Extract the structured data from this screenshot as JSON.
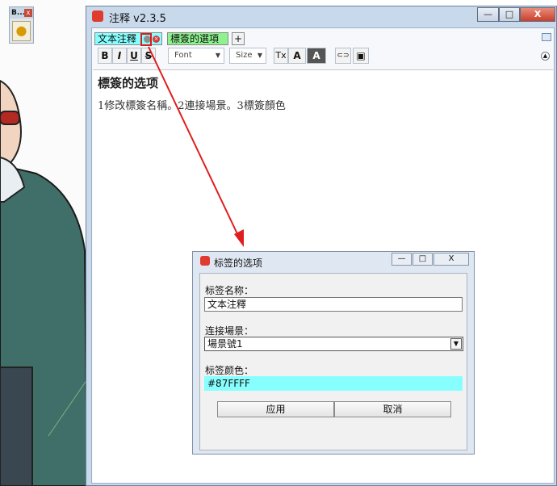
{
  "background": {
    "toolbar_title": "B...",
    "toolbar_close": "x",
    "toolbar_icon": "speech-bubble-icon"
  },
  "window": {
    "title": "注释 v2.3.5",
    "controls": {
      "minimize": "—",
      "maximize": "□",
      "close": "X"
    }
  },
  "tabs": [
    {
      "label": "文本注釋",
      "color": "#87FFFF"
    },
    {
      "label": "標簽的選項",
      "color": "#8EF38E"
    }
  ],
  "tab_add_label": "+",
  "toolbar": {
    "bold": "B",
    "italic": "I",
    "underline": "U",
    "strike": "S",
    "font_placeholder": "Font",
    "size_placeholder": "Size",
    "clear_format": "Tx",
    "text_color": "A",
    "bg_color": "A",
    "link": "⊂⊃",
    "image": "▣"
  },
  "document": {
    "heading": "標簽的选项",
    "line": "1修改標簽名稱。2連接場景。3標簽顏色"
  },
  "dialog": {
    "title": "标签的选项",
    "name_label": "标签名称：",
    "name_value": "文本注釋",
    "scene_label": "连接場景：",
    "scene_value": "場景號1",
    "color_label": "标签颜色：",
    "color_value": "#87FFFF",
    "apply_button": "应用",
    "cancel_button": "取消",
    "controls": {
      "minimize": "—",
      "maximize": "□",
      "close": "X"
    }
  },
  "colors": {
    "annotation_arrow": "#E01E1E",
    "swatch": "#87FFFF"
  }
}
